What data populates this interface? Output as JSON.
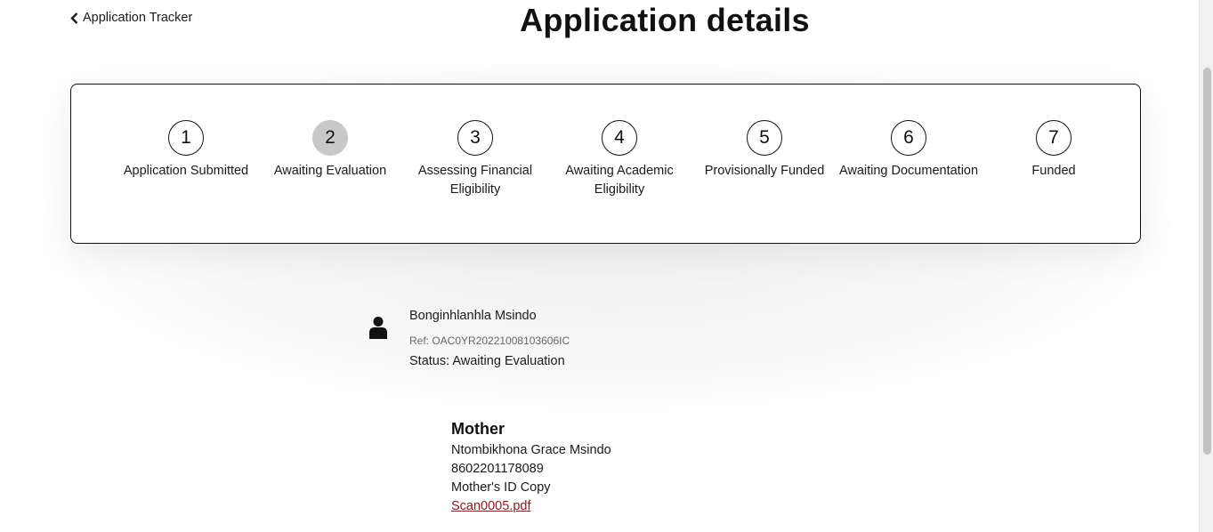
{
  "header": {
    "back_label": "Application Tracker",
    "title": "Application details"
  },
  "stepper": {
    "active_step": 2,
    "steps": [
      {
        "number": "1",
        "label": "Application Submitted"
      },
      {
        "number": "2",
        "label": "Awaiting Evaluation"
      },
      {
        "number": "3",
        "label": "Assessing Financial Eligibility"
      },
      {
        "number": "4",
        "label": "Awaiting Academic Eligibility"
      },
      {
        "number": "5",
        "label": "Provisionally Funded"
      },
      {
        "number": "6",
        "label": "Awaiting Documentation"
      },
      {
        "number": "7",
        "label": "Funded"
      }
    ]
  },
  "applicant": {
    "icon": "user-icon",
    "name": "Bonginhlanhla Msindo",
    "ref": "Ref: OAC0YR20221008103606IC",
    "status": "Status: Awaiting Evaluation"
  },
  "mother": {
    "heading": "Mother",
    "name": "Ntombikhona Grace Msindo",
    "id_number": "8602201178089",
    "document_type": "Mother's ID Copy",
    "file_name": "Scan0005.pdf"
  },
  "colors": {
    "active_step": "#c8c8c8",
    "link": "#8b1a1a"
  }
}
